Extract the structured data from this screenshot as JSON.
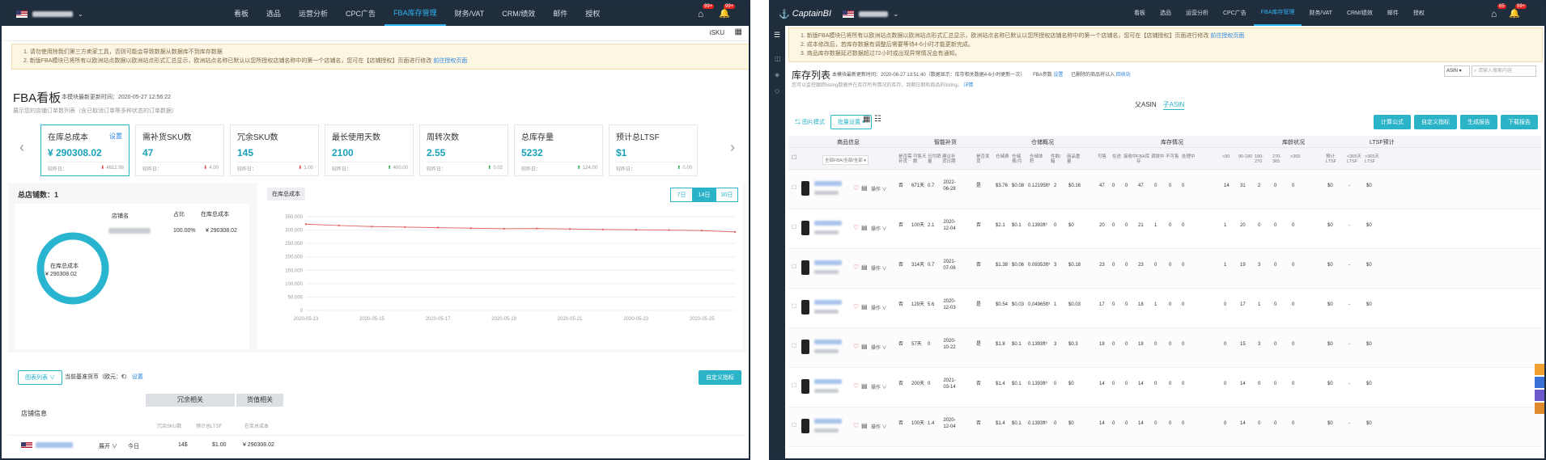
{
  "left": {
    "nav": [
      "看板",
      "选品",
      "运营分析",
      "CPC广告",
      "FBA库存管理",
      "财务/VAT",
      "CRM/绩效",
      "邮件",
      "授权"
    ],
    "active_nav": "FBA库存管理",
    "badge1": "99+",
    "badge2": "99+",
    "isku": "iSKU",
    "notice1": "1. 请勿使用除我们第三方卖家工具，否则可能会导致数据从数据库不到库存数据",
    "notice2": "2. 新版FBA模块已将所有以欧洲站点数据以欧洲站点形式汇总显示，欧洲站点名称已默认以您所授权店铺名称中的第一个店铺名，您可在【店铺授权】页面进行修改",
    "notice_link": "前往授权页面",
    "title": "FBA看板",
    "update_label": "本模块最新更新时间：",
    "update_time": "2020-05-27 12:56:22",
    "subtitle": "展示您的店铺订单数列表（含已取消订单等多种状态的订单数据）",
    "cards": [
      {
        "title": "在库总成本",
        "value": "¥ 290308.02",
        "footer_label": "较昨日：",
        "change": "4612.98",
        "dir": "down",
        "link": "设置"
      },
      {
        "title": "需补货SKU数",
        "value": "47",
        "footer_label": "较昨日：",
        "change": "4.00",
        "dir": "down"
      },
      {
        "title": "冗余SKU数",
        "value": "145",
        "footer_label": "较昨日：",
        "change": "1.00",
        "dir": "down"
      },
      {
        "title": "最长使用天数",
        "value": "2100",
        "footer_label": "较昨日：",
        "change": "400.00",
        "dir": "up"
      },
      {
        "title": "周转次数",
        "value": "2.55",
        "footer_label": "较昨日：",
        "change": "0.02",
        "dir": "up"
      },
      {
        "title": "总库存量",
        "value": "5232",
        "footer_label": "较昨日：",
        "change": "124.00",
        "dir": "up"
      },
      {
        "title": "预计总LTSF",
        "value": "$1",
        "footer_label": "较昨日：",
        "change": "0.00",
        "dir": "up"
      }
    ],
    "store_count_label": "总店铺数：",
    "store_count": "1",
    "store_table_headers": [
      "店铺名",
      "占比",
      "在库总成本"
    ],
    "store_row": {
      "pct": "100.00%",
      "cost": "¥ 290308.02"
    },
    "donut_label": "在库总成本",
    "donut_value": "¥ 290308.02",
    "chart_tag": "在库总成本",
    "ranges": [
      "7日",
      "14日",
      "30日"
    ],
    "active_range": "14日",
    "chart_data": {
      "type": "line",
      "x": [
        "2020-05-13",
        "2020-05-14",
        "2020-05-15",
        "2020-05-16",
        "2020-05-17",
        "2020-05-18",
        "2020-05-19",
        "2020-05-20",
        "2020-05-21",
        "2020-05-22",
        "2020-05-23",
        "2020-05-24",
        "2020-05-25",
        "2020-05-26"
      ],
      "xticks": [
        "2020-05-13",
        "2020-05-15",
        "2020-05-17",
        "2020-05-19",
        "2020-05-21",
        "2020-05-23",
        "2020-05-25"
      ],
      "series": [
        {
          "values": [
            322000,
            317000,
            313000,
            311000,
            309000,
            307000,
            305000,
            306000,
            304000,
            302000,
            301000,
            300000,
            298000,
            293000
          ]
        }
      ],
      "yticks": [
        "350,000",
        "300,000",
        "250,000",
        "200,000",
        "150,000",
        "100,000",
        "50,000",
        "0"
      ],
      "ylim": [
        0,
        350000
      ],
      "color": "#e06a6a"
    },
    "tool_btn": "图表列表",
    "currency_label": "当前基准货币（欧元：€）",
    "currency_link": "设置",
    "custom_btn": "自定义指标",
    "table_groups": [
      "冗余相关",
      "货值相关"
    ],
    "store_info": "店铺信息",
    "sub_headers": [
      "冗余SKU数",
      "预计总LTSF",
      "在库总成本"
    ],
    "row": {
      "expand": "展开 ∨",
      "today": "今日",
      "sku": "14$",
      "ltsf": "$1.00",
      "cost": "¥ 290308.02"
    }
  },
  "right": {
    "brand": "CaptainBI",
    "nav": [
      "看板",
      "选品",
      "运营分析",
      "CPC广告",
      "FBA库存管理",
      "财务/VAT",
      "CRM/绩效",
      "邮件",
      "授权"
    ],
    "active_nav": "FBA库存管理",
    "badge1": "65",
    "badge2": "99+",
    "notice1": "1. 新版FBA模块已将所有以欧洲站点数据以欧洲站点形式汇总显示，欧洲站点名称已默认以您所授权店铺名称中的第一个店铺名，您可在【店铺授权】页面进行修改",
    "notice_link": "前往授权页面",
    "notice2": "2. 成本修改后，若库存数据有调整后需要等待4-6小时才能更新完成。",
    "notice3": "3. 商品库存数据延迟数据超过72小时或出现异常情况会有通知。",
    "title": "库存列表",
    "update_label": "本模块最新更新时间：",
    "update_time": "2020-08-27 13:51:40（数据显示：库存相关数据4-6小时更新一次）",
    "fba_label": "FBA参数",
    "fba_link": "设置",
    "hidden_label": "已删除的商品将以入",
    "hidden_link": "回收站",
    "sub_note": "您可以监控跟踪listing数据并在库存所有情况的库存，到期日期和商品的listing。",
    "sub_link": "详情",
    "search_select": "ASIN ▾",
    "search_placeholder": "请输入搜索内容",
    "tabs": [
      "父ASIN",
      "子ASIN"
    ],
    "active_tab": "子ASIN",
    "mode_btn": "图片模式",
    "batch_btn": "批量设置",
    "action_btns": [
      "计算公式",
      "自定义指标",
      "生成报告",
      "下载报告"
    ],
    "group_headers": [
      "商品信息",
      "智能补货",
      "仓储概况",
      "库存情况",
      "库龄状况",
      "LTSF预计"
    ],
    "filter": "全部FBA/全部/全部 ▾",
    "col_headers": [
      "是否需补货",
      "可售天数",
      "日均销量",
      "建议补货日期",
      "是否发货",
      "仓储费",
      "仓储费/月",
      "仓储体积",
      "件数/箱",
      "商品重量",
      "可售",
      "在途",
      "接收中",
      "FBA库存",
      "调拨中",
      "不可售",
      "处理中",
      "<90",
      "90-180",
      "180-270",
      "270-365",
      ">365",
      "预计LTSF",
      "<365天LTSF",
      ">365天LTSF"
    ],
    "rows": [
      {
        "need": "否",
        "days": "671天",
        "avg": "0.7",
        "date": "2022-06-28",
        "ship": "是",
        "fee": "$3.76",
        "fee_m": "$0.08",
        "vol": "0.12195ft³",
        "qty": "2",
        "w": "$0.16",
        "sell": "47",
        "onw": "0",
        "rec": "0",
        "fba": "47",
        "tr": "0",
        "uns": "0",
        "proc": "0",
        "a1": "14",
        "a2": "31",
        "a3": "2",
        "a4": "0",
        "a5": "0",
        "l1": "$0",
        "l2": "-",
        "l3": "$0"
      },
      {
        "need": "否",
        "days": "100天",
        "avg": "2.1",
        "date": "2020-12-04",
        "ship": "否",
        "fee": "$2.1",
        "fee_m": "$0.1",
        "vol": "0.1393ft³",
        "qty": "0",
        "w": "$0",
        "sell": "20",
        "onw": "0",
        "rec": "0",
        "fba": "21",
        "tr": "1",
        "uns": "0",
        "proc": "0",
        "a1": "1",
        "a2": "20",
        "a3": "0",
        "a4": "0",
        "a5": "0",
        "l1": "$0",
        "l2": "-",
        "l3": "$0"
      },
      {
        "need": "否",
        "days": "314天",
        "avg": "0.7",
        "date": "2021-07-06",
        "ship": "否",
        "fee": "$1.38",
        "fee_m": "$0.06",
        "vol": "0.09353ft³",
        "qty": "3",
        "w": "$0.18",
        "sell": "23",
        "onw": "0",
        "rec": "0",
        "fba": "23",
        "tr": "0",
        "uns": "0",
        "proc": "0",
        "a1": "1",
        "a2": "19",
        "a3": "3",
        "a4": "0",
        "a5": "0",
        "l1": "$0",
        "l2": "-",
        "l3": "$0"
      },
      {
        "need": "否",
        "days": "129天",
        "avg": "5.6",
        "date": "2020-12-03",
        "ship": "是",
        "fee": "$0.54",
        "fee_m": "$0.03",
        "vol": "0.04965ft³",
        "qty": "1",
        "w": "$0.03",
        "sell": "17",
        "onw": "0",
        "rec": "0",
        "fba": "18",
        "tr": "1",
        "uns": "0",
        "proc": "0",
        "a1": "0",
        "a2": "17",
        "a3": "1",
        "a4": "0",
        "a5": "0",
        "l1": "$0",
        "l2": "-",
        "l3": "$0"
      },
      {
        "need": "否",
        "days": "57天",
        "avg": "0",
        "date": "2020-10-22",
        "ship": "是",
        "fee": "$1.8",
        "fee_m": "$0.1",
        "vol": "0.1393ft³",
        "qty": "3",
        "w": "$0.3",
        "sell": "18",
        "onw": "0",
        "rec": "0",
        "fba": "18",
        "tr": "0",
        "uns": "0",
        "proc": "0",
        "a1": "0",
        "a2": "15",
        "a3": "3",
        "a4": "0",
        "a5": "0",
        "l1": "$0",
        "l2": "-",
        "l3": "$0"
      },
      {
        "need": "否",
        "days": "200天",
        "avg": "0",
        "date": "2021-03-14",
        "ship": "否",
        "fee": "$1.4",
        "fee_m": "$0.1",
        "vol": "0.1393ft³",
        "qty": "0",
        "w": "$0",
        "sell": "14",
        "onw": "0",
        "rec": "0",
        "fba": "14",
        "tr": "0",
        "uns": "0",
        "proc": "0",
        "a1": "0",
        "a2": "14",
        "a3": "0",
        "a4": "0",
        "a5": "0",
        "l1": "$0",
        "l2": "-",
        "l3": "$0"
      },
      {
        "need": "否",
        "days": "100天",
        "avg": "1.4",
        "date": "2020-12-04",
        "ship": "否",
        "fee": "$1.4",
        "fee_m": "$0.1",
        "vol": "0.1393ft³",
        "qty": "0",
        "w": "$0",
        "sell": "14",
        "onw": "0",
        "rec": "0",
        "fba": "14",
        "tr": "0",
        "uns": "0",
        "proc": "0",
        "a1": "0",
        "a2": "14",
        "a3": "0",
        "a4": "0",
        "a5": "0",
        "l1": "$0",
        "l2": "-",
        "l3": "$0"
      }
    ],
    "op_label": "操作 ∨"
  }
}
